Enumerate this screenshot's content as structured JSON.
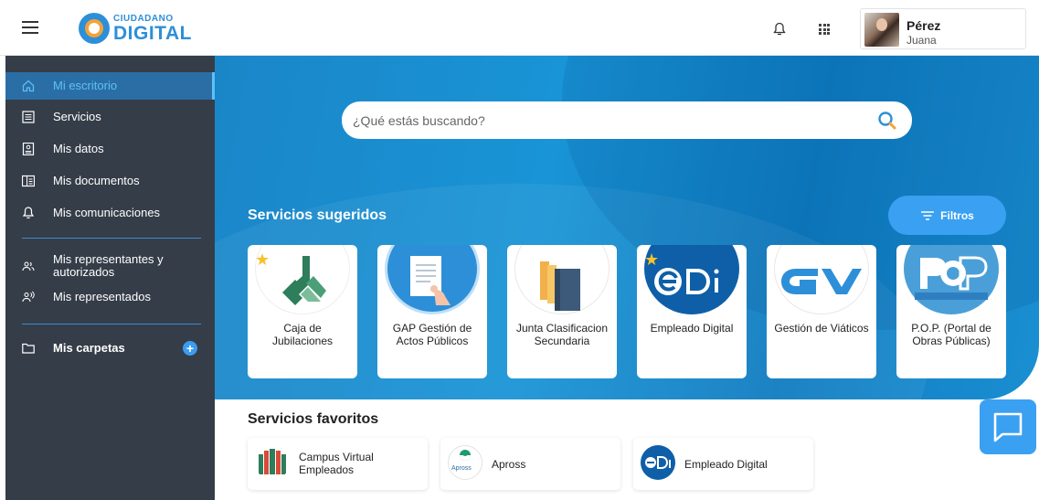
{
  "header": {
    "logo_top": "CIUDADANO",
    "logo_bottom": "DIGITAL",
    "user_last_name": "Pérez",
    "user_first_name": "Juana"
  },
  "sidebar": {
    "items": [
      {
        "label": "Mi escritorio",
        "icon": "home-icon"
      },
      {
        "label": "Servicios",
        "icon": "list-icon"
      },
      {
        "label": "Mis datos",
        "icon": "id-card-icon"
      },
      {
        "label": "Mis documentos",
        "icon": "document-icon"
      },
      {
        "label": "Mis comunicaciones",
        "icon": "bell-icon"
      },
      {
        "label": "Mis representantes y autorizados",
        "icon": "people-icon"
      },
      {
        "label": "Mis representados",
        "icon": "person-speaking-icon"
      },
      {
        "label": "Mis carpetas",
        "icon": "folder-icon"
      }
    ]
  },
  "search": {
    "placeholder": "¿Qué estás buscando?"
  },
  "suggested": {
    "title": "Servicios sugeridos",
    "filters_label": "Filtros",
    "cards": [
      {
        "label": "Caja de Jubilaciones",
        "favorite": true
      },
      {
        "label": "GAP Gestión de Actos Públicos",
        "favorite": false
      },
      {
        "label": "Junta Clasificacion Secundaria",
        "favorite": false
      },
      {
        "label": "Empleado Digital",
        "favorite": true,
        "logo_text": "eDi"
      },
      {
        "label": "Gestión de Viáticos",
        "favorite": false,
        "logo_text": "GV"
      },
      {
        "label": "P.O.P. (Portal de Obras Públicas)",
        "favorite": false,
        "logo_text": "POP",
        "logo_subtext": "Portal de Obras Públicas"
      }
    ]
  },
  "favorites": {
    "title": "Servicios favoritos",
    "items": [
      {
        "label": "Campus Virtual Empleados"
      },
      {
        "label": "Apross",
        "logo_text": "Apross"
      },
      {
        "label": "Empleado Digital",
        "logo_text": "eDi"
      }
    ]
  },
  "colors": {
    "sidebar_bg": "#353d48",
    "active_bg": "#2b6ea6",
    "accent": "#3aa0f2",
    "hero_blue": "#1994d6",
    "star": "#f7c22b"
  }
}
